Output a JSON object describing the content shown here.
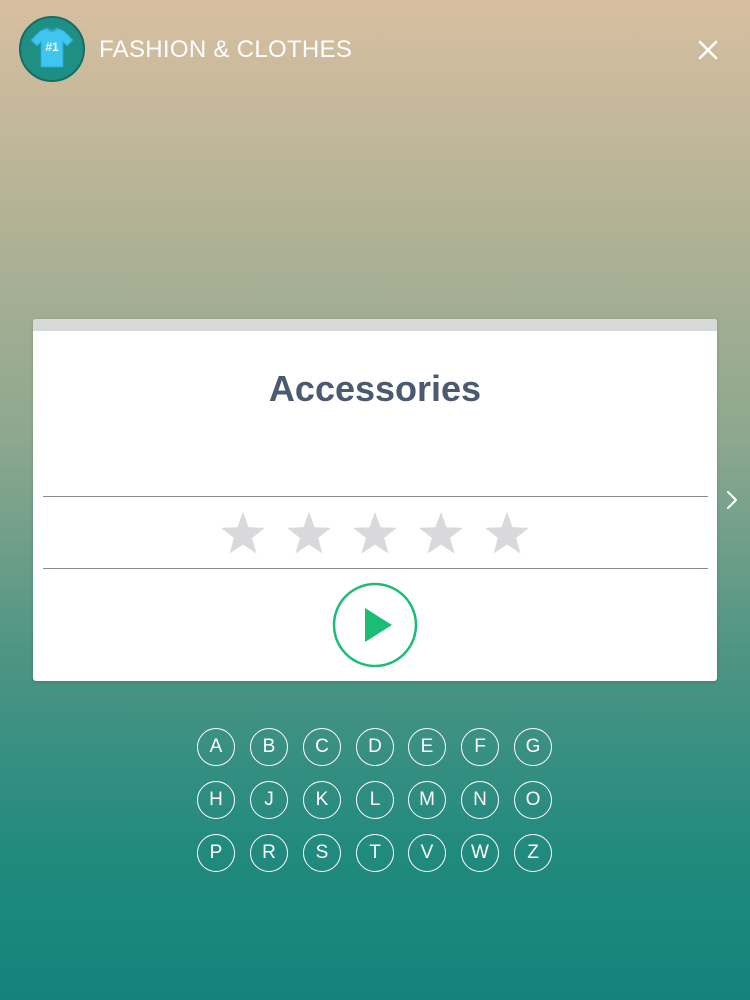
{
  "header": {
    "category_title": "FASHION & CLOTHES",
    "logo_badge": "#1",
    "logo_icon": "tshirt-icon",
    "close_icon": "close-icon"
  },
  "card": {
    "level_title": "Accessories",
    "stars_earned": 0,
    "stars_total": 5,
    "play_icon": "play-icon"
  },
  "letters": {
    "row1": [
      "A",
      "B",
      "C",
      "D",
      "E",
      "F",
      "G"
    ],
    "row2": [
      "H",
      "J",
      "K",
      "L",
      "M",
      "N",
      "O"
    ],
    "row3": [
      "P",
      "R",
      "S",
      "T",
      "V",
      "W",
      "Z"
    ]
  },
  "colors": {
    "accent": "#1bbc75",
    "title": "#4a5a70",
    "star_empty": "#d9d9dc"
  }
}
